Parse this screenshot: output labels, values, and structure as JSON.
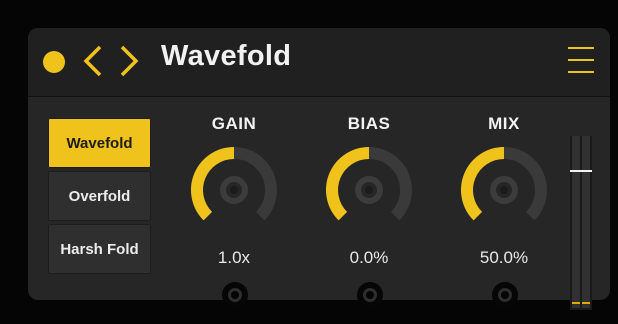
{
  "header": {
    "title": "Wavefold",
    "icons": [
      "status-dot",
      "chevron-left-icon",
      "chevron-right-icon",
      "hamburger-menu-icon"
    ]
  },
  "modes": [
    {
      "label": "Wavefold",
      "active": true
    },
    {
      "label": "Overfold",
      "active": false
    },
    {
      "label": "Harsh Fold",
      "active": false
    }
  ],
  "knobs": [
    {
      "label": "GAIN",
      "value": "1.0x",
      "level": 0.5
    },
    {
      "label": "BIAS",
      "value": "0.0%",
      "level": 0.5
    },
    {
      "label": "MIX",
      "value": "50.0%",
      "level": 0.5
    }
  ],
  "meter": {
    "level": 0.8
  },
  "colors": {
    "accent": "#f0c21c",
    "panel": "#262626",
    "header": "#202020",
    "track": "#3a3a3a",
    "background": "#050505"
  }
}
